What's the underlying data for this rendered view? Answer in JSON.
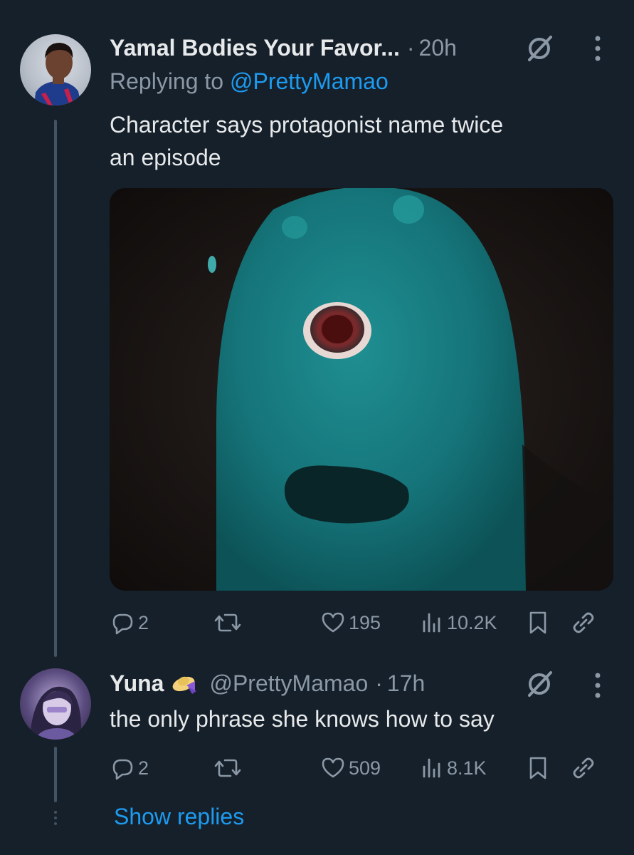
{
  "tweets": [
    {
      "display_name": "Yamal Bodies Your Favor...",
      "time": "20h",
      "replying_label": "Replying to",
      "replying_to": "@PrettyMamao",
      "text_line1": "Character says protagonist name twice",
      "text_line2": "an episode",
      "media_icon": "blue-one-eyed-creature-image",
      "stats": {
        "replies": "2",
        "likes": "195",
        "views": "10.2K"
      }
    },
    {
      "display_name": "Yuna",
      "badge_icon": "hat-with-bow-emoji",
      "handle": "@PrettyMamao",
      "time": "17h",
      "text": "the only phrase she knows how to say",
      "stats": {
        "replies": "2",
        "likes": "509",
        "views": "8.1K"
      }
    }
  ],
  "show_replies": "Show replies",
  "separator": "·",
  "colors": {
    "background": "#15202b",
    "text_primary": "#e7e9ea",
    "text_secondary": "#8b98a5",
    "accent": "#1d9bf0",
    "thread_line": "#425364"
  }
}
